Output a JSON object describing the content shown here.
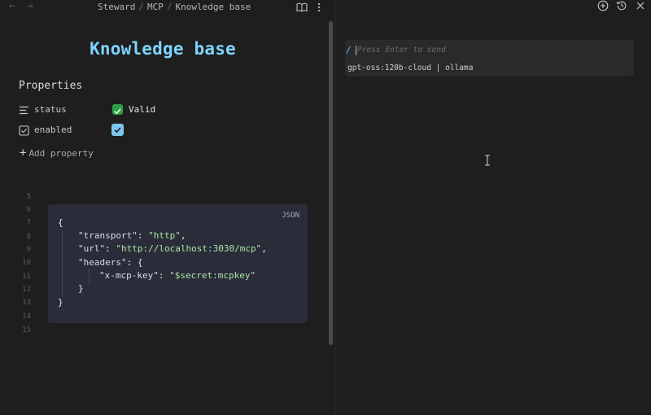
{
  "nav": {
    "back_icon": "arrow-left-icon",
    "forward_icon": "arrow-right-icon",
    "breadcrumb": [
      "Steward",
      "MCP",
      "Knowledge base"
    ],
    "reader_icon": "book-open-icon",
    "more_icon": "more-vertical-icon"
  },
  "page": {
    "title": "Knowledge base",
    "properties_heading": "Properties",
    "properties": [
      {
        "key": "status",
        "icon": "text-lines-icon",
        "value": "Valid",
        "checked": true,
        "check_color": "#2ea043"
      },
      {
        "key": "enabled",
        "icon": "checkbox-icon",
        "value": "",
        "checked": true,
        "check_color": "#7cc7f0"
      }
    ],
    "add_property_label": "Add property"
  },
  "code": {
    "language": "JSON",
    "line_numbers": [
      "5",
      "6",
      "7",
      "8",
      "9",
      "10",
      "11",
      "12",
      "13",
      "14",
      "15"
    ],
    "lines": {
      "open_brace": "{",
      "transport_key": "\"transport\"",
      "transport_val": "\"http\"",
      "url_key": "\"url\"",
      "url_val": "\"http://localhost:3030/mcp\"",
      "headers_key": "\"headers\"",
      "headers_open": "{",
      "mcpkey_key": "\"x-mcp-key\"",
      "mcpkey_val": "\"$secret:mcpkey\"",
      "headers_close": "}",
      "close_brace": "}"
    }
  },
  "chat": {
    "new_chat_icon": "plus-circle-icon",
    "history_icon": "history-icon",
    "close_icon": "close-icon",
    "slash_prefix": "/",
    "placeholder": "Press Enter to send",
    "model_info": "gpt-oss:120b-cloud | ollama"
  },
  "colors": {
    "title": "#7fd4ff",
    "background": "#1e1e1e",
    "code_background": "#2b2c3a",
    "string": "#a8e6a1",
    "accent": "#6fb0ff"
  }
}
